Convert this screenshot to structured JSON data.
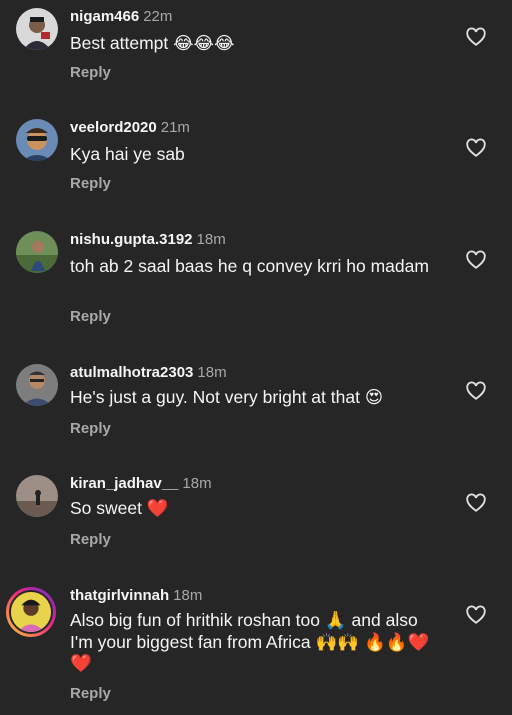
{
  "comments": [
    {
      "username": "nigam466",
      "time": "22m",
      "text": "Best attempt 😂😂😂",
      "reply": "Reply"
    },
    {
      "username": "veelord2020",
      "time": "21m",
      "text": "Kya hai ye sab",
      "reply": "Reply"
    },
    {
      "username": "nishu.gupta.3192",
      "time": "18m",
      "text": "toh ab 2 saal baas he q convey krri ho madam",
      "reply": "Reply"
    },
    {
      "username": "atulmalhotra2303",
      "time": "18m",
      "text": "He's just a guy. Not very bright at that 😍",
      "reply": "Reply"
    },
    {
      "username": "kiran_jadhav__",
      "time": "18m",
      "text": "So sweet ❤️",
      "reply": "Reply"
    },
    {
      "username": "thatgirlvinnah",
      "time": "18m",
      "text": "Also big fun of hrithik roshan too 🙏 and also I'm your biggest fan from Africa 🙌🙌 🔥🔥❤️❤️",
      "reply": "Reply"
    }
  ],
  "icons": {
    "like": "heart-outline-icon"
  },
  "colors": {
    "background": "#262626",
    "text": "#f5f5f5",
    "secondary": "#a8a8a8"
  }
}
